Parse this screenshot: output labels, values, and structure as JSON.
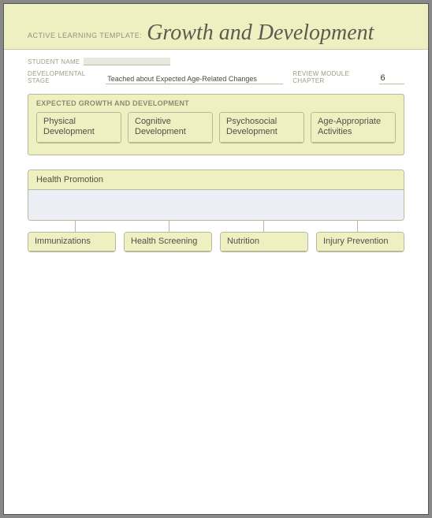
{
  "header": {
    "template_label": "ACTIVE LEARNING TEMPLATE:",
    "title": "Growth and Development"
  },
  "meta": {
    "student_label": "STUDENT NAME",
    "student_value": "",
    "stage_label": "DEVELOPMENTAL STAGE",
    "stage_value": "Teached about Expected Age-Related Changes",
    "chapter_label": "REVIEW MODULE CHAPTER",
    "chapter_value": "6"
  },
  "section1": {
    "title": "EXPECTED GROWTH AND DEVELOPMENT",
    "cards": [
      "Physical Development",
      "Cognitive Development",
      "Psychosocial Development",
      "Age-Appropriate Activities"
    ]
  },
  "health_promotion": {
    "title": "Health Promotion",
    "subs": [
      "Immunizations",
      "Health Screening",
      "Nutrition",
      "Injury Prevention"
    ]
  }
}
